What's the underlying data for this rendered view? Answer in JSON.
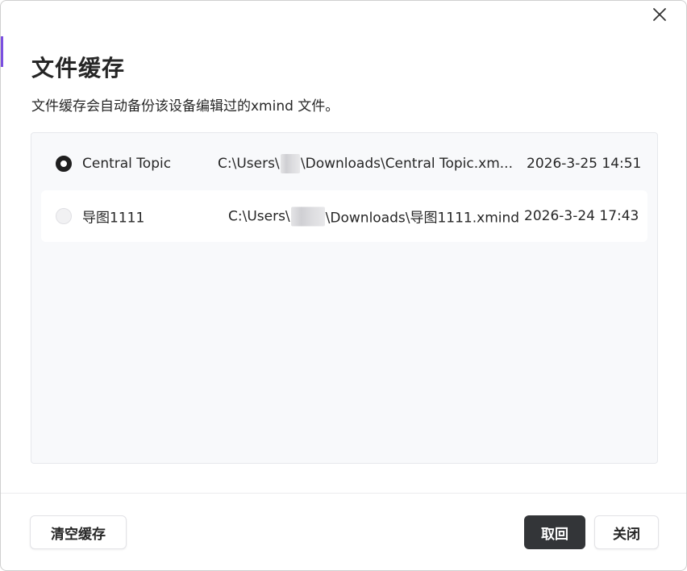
{
  "dialog": {
    "title": "文件缓存",
    "subtitle": "文件缓存会自动备份该设备编辑过的xmind 文件。",
    "close_icon": "close-icon"
  },
  "files": [
    {
      "name": "Central Topic",
      "path_prefix": "C:\\Users\\",
      "path_suffix": "\\Downloads\\Central Topic.xm...",
      "date": "2026-3-25 14:51",
      "selected": true
    },
    {
      "name": "导图1111",
      "path_prefix": "C:\\Users\\",
      "path_suffix": "\\Downloads\\导图1111.xmind",
      "date": "2026-3-24 17:43",
      "selected": false
    }
  ],
  "buttons": {
    "clear_cache": "清空缓存",
    "restore": "取回",
    "close": "关闭"
  },
  "colors": {
    "primary_button": "#333538",
    "accent": "#7b4fe0",
    "panel_bg": "#f8f9fb"
  }
}
